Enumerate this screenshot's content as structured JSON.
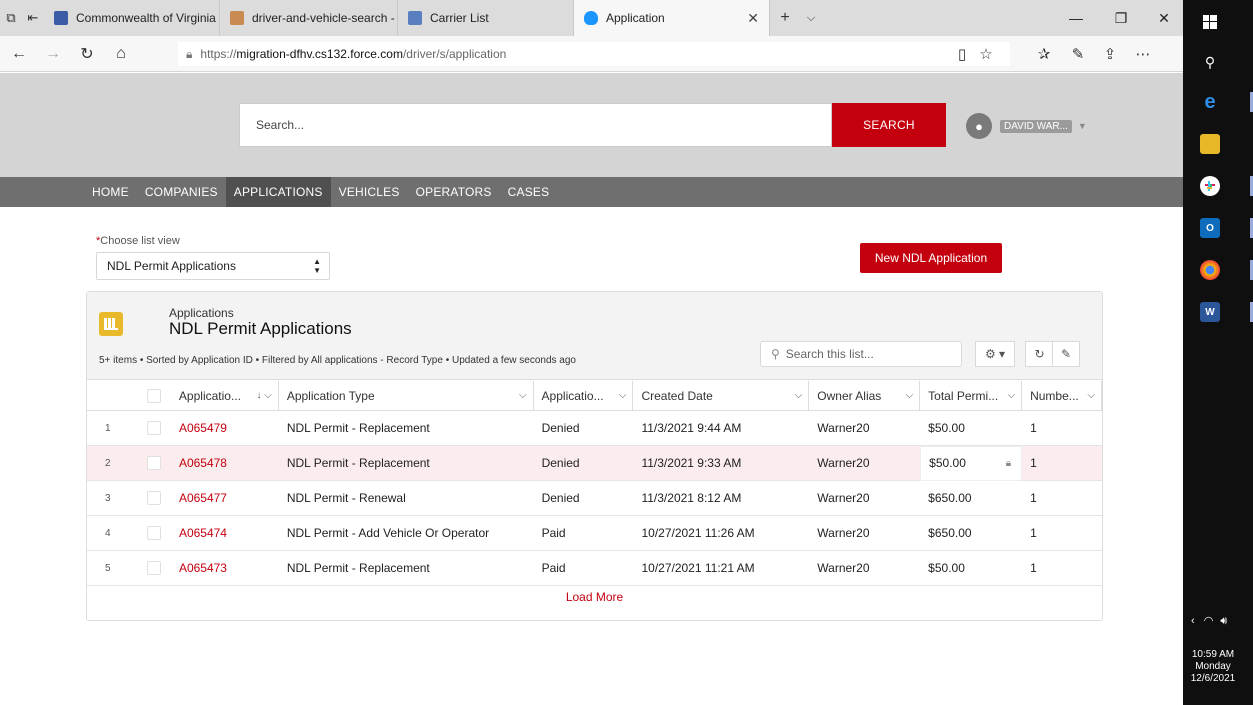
{
  "browser": {
    "tabs": [
      {
        "label": "Commonwealth of Virginia",
        "favicon_color": "#3b5ba5"
      },
      {
        "label": "driver-and-vehicle-search -",
        "favicon_color": "#c98a52"
      },
      {
        "label": "Carrier List",
        "favicon_color": "#5a7fbf"
      },
      {
        "label": "Application",
        "favicon_color": "#1b96ff"
      }
    ],
    "url_prefix": "https://",
    "url_host": "migration-dfhv.cs132.force.com",
    "url_path": "/driver/s/application"
  },
  "header": {
    "search_placeholder": "Search...",
    "search_button": "SEARCH",
    "user_name": "DAVID WAR..."
  },
  "nav": {
    "items": [
      "HOME",
      "COMPANIES",
      "APPLICATIONS",
      "VEHICLES",
      "OPERATORS",
      "CASES"
    ],
    "active": "APPLICATIONS"
  },
  "list_view": {
    "required_mark": "*",
    "label": "Choose list view",
    "selected": "NDL Permit Applications",
    "new_button": "New NDL Application"
  },
  "panel": {
    "object_name": "Applications",
    "view_name": "NDL Permit Applications",
    "meta": "5+ items • Sorted by Application ID • Filtered by All applications - Record Type • Updated a few seconds ago",
    "search_placeholder": "Search this list...",
    "load_more": "Load More"
  },
  "table": {
    "columns": [
      "Applicatio...",
      "Application Type",
      "Applicatio...",
      "Created Date",
      "Owner Alias",
      "Total Permi...",
      "Numbe..."
    ],
    "rows": [
      {
        "num": "1",
        "id": "A065479",
        "type": "NDL Permit - Replacement",
        "status": "Denied",
        "created": "11/3/2021 9:44 AM",
        "owner": "Warner20",
        "total": "$50.00",
        "number": "1"
      },
      {
        "num": "2",
        "id": "A065478",
        "type": "NDL Permit - Replacement",
        "status": "Denied",
        "created": "11/3/2021 9:33 AM",
        "owner": "Warner20",
        "total": "$50.00",
        "number": "1"
      },
      {
        "num": "3",
        "id": "A065477",
        "type": "NDL Permit - Renewal",
        "status": "Denied",
        "created": "11/3/2021 8:12 AM",
        "owner": "Warner20",
        "total": "$650.00",
        "number": "1"
      },
      {
        "num": "4",
        "id": "A065474",
        "type": "NDL Permit - Add Vehicle Or Operator",
        "status": "Paid",
        "created": "10/27/2021 11:26 AM",
        "owner": "Warner20",
        "total": "$650.00",
        "number": "1"
      },
      {
        "num": "5",
        "id": "A065473",
        "type": "NDL Permit - Replacement",
        "status": "Paid",
        "created": "10/27/2021 11:21 AM",
        "owner": "Warner20",
        "total": "$50.00",
        "number": "1"
      }
    ]
  },
  "taskbar": {
    "time": "10:59 AM",
    "day": "Monday",
    "date": "12/6/2021"
  },
  "colors": {
    "brand_red": "#c4000f",
    "nav_gray": "#6f6f6f"
  }
}
